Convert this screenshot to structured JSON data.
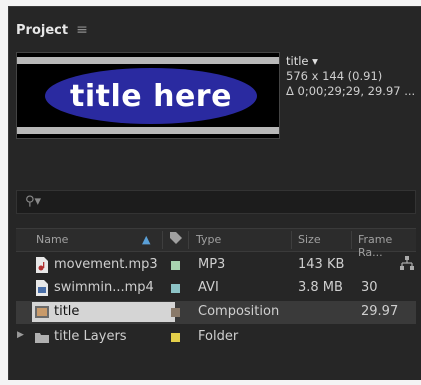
{
  "panel": {
    "title": "Project",
    "menu_icon": "hamburger-menu-icon"
  },
  "preview": {
    "thumbnail_text": "title here",
    "name": "title ▾",
    "dimensions": "576 x 144 (0.91)",
    "duration": "Δ 0;00;29;29, 29.97 ..."
  },
  "search": {
    "icon": "search-icon",
    "value": ""
  },
  "columns": {
    "name": "Name",
    "label": "label-tag-icon",
    "type": "Type",
    "size": "Size",
    "frame_rate": "Frame Ra..."
  },
  "items": [
    {
      "name": "movement.mp3",
      "type": "MP3",
      "size": "143 KB",
      "frame_rate": "",
      "label_color": "#a9d3b0",
      "icon": "audio-file-icon"
    },
    {
      "name": "swimmin...mp4",
      "type": "AVI",
      "size": "3.8 MB",
      "frame_rate": "30",
      "label_color": "#8cc3c6",
      "icon": "video-file-icon"
    },
    {
      "name": "title",
      "type": "Composition",
      "size": "",
      "frame_rate": "29.97",
      "label_color": "#8a7a6a",
      "icon": "composition-icon"
    },
    {
      "name": "title Layers",
      "type": "Folder",
      "size": "",
      "frame_rate": "",
      "label_color": "#e3cf4a",
      "icon": "folder-icon"
    }
  ],
  "colors": {
    "panel_bg": "#262626",
    "thumbnail_oval": "#2a2aa0",
    "selection": "#d5d5d5"
  }
}
